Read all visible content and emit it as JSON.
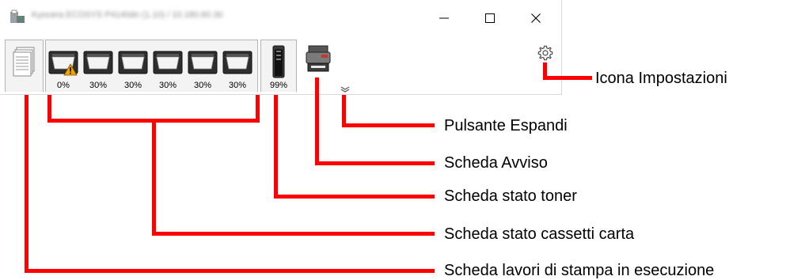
{
  "window": {
    "title": "Kyocera ECOSYS P4140dn (1.10) / 10.180.60.30",
    "minimize_glyph": "–",
    "maximize_glyph": "☐",
    "close_glyph": "✕"
  },
  "icons": {
    "app": "printer-app-icon",
    "print_jobs": "document-stack-icon",
    "tray": "paper-tray-icon",
    "warning": "warning-icon",
    "toner": "toner-cartridge-icon",
    "alert": "printer-device-icon",
    "expand": "double-chevron-down-icon",
    "settings": "gear-icon"
  },
  "trays": [
    {
      "percent": "0%",
      "warning": true
    },
    {
      "percent": "30%",
      "warning": false
    },
    {
      "percent": "30%",
      "warning": false
    },
    {
      "percent": "30%",
      "warning": false
    },
    {
      "percent": "30%",
      "warning": false
    },
    {
      "percent": "30%",
      "warning": false
    }
  ],
  "toner": {
    "percent": "99%",
    "level": 0.99
  },
  "callouts": {
    "settings_icon": "Icona Impostazioni",
    "expand_button": "Pulsante Espandi",
    "alert_tab": "Scheda Avviso",
    "toner_tab": "Scheda stato toner",
    "trays_tab": "Scheda stato cassetti carta",
    "print_jobs_tab": "Scheda lavori di stampa in esecuzione"
  },
  "colors": {
    "callout_line": "#ff0000",
    "warning": "#f0a500",
    "tab_border": "#b4b4b4"
  }
}
